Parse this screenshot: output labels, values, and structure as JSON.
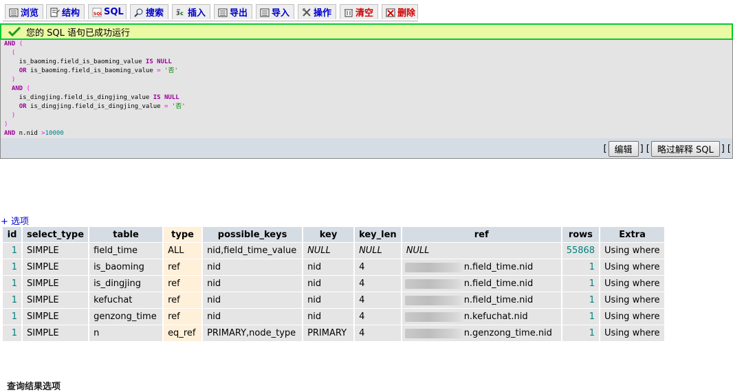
{
  "tabs": [
    {
      "label": "浏览",
      "icon": "browse-icon"
    },
    {
      "label": "结构",
      "icon": "structure-icon"
    },
    {
      "label": "SQL",
      "icon": "sql-icon"
    },
    {
      "label": "搜索",
      "icon": "search-icon"
    },
    {
      "label": "插入",
      "icon": "insert-icon"
    },
    {
      "label": "导出",
      "icon": "export-icon"
    },
    {
      "label": "导入",
      "icon": "import-icon"
    },
    {
      "label": "操作",
      "icon": "operations-icon"
    },
    {
      "label": "清空",
      "icon": "empty-icon"
    },
    {
      "label": "删除",
      "icon": "drop-icon"
    }
  ],
  "success": {
    "message": "您的 SQL 语句已成功运行"
  },
  "sql_lines": [
    "AND (",
    "  (",
    "    is_baoming.field_is_baoming_value IS NULL",
    "    OR is_baoming.field_is_baoming_value = '否'",
    "  )",
    "  AND (",
    "    is_dingjing.field_is_dingjing_value IS NULL",
    "    OR is_dingjing.field_is_dingjing_value = '否'",
    "  )",
    ")",
    "AND n.nid >10000"
  ],
  "sql_actions": {
    "edit": "编辑",
    "skip_explain": "略过解释 SQL"
  },
  "options_link": "+ 选项",
  "results": {
    "columns": [
      "id",
      "select_type",
      "table",
      "type",
      "possible_keys",
      "key",
      "key_len",
      "ref",
      "rows",
      "Extra"
    ],
    "rows": [
      [
        "1",
        "SIMPLE",
        "field_time",
        "ALL",
        "nid,field_time_value",
        "NULL",
        "NULL",
        "NULL",
        "55868",
        "Using where"
      ],
      [
        "1",
        "SIMPLE",
        "is_baoming",
        "ref",
        "nid",
        "nid",
        "4",
        "n.field_time.nid",
        "1",
        "Using where"
      ],
      [
        "1",
        "SIMPLE",
        "is_dingjing",
        "ref",
        "nid",
        "nid",
        "4",
        "n.field_time.nid",
        "1",
        "Using where"
      ],
      [
        "1",
        "SIMPLE",
        "kefuchat",
        "ref",
        "nid",
        "nid",
        "4",
        "n.field_time.nid",
        "1",
        "Using where"
      ],
      [
        "1",
        "SIMPLE",
        "genzong_time",
        "ref",
        "nid",
        "nid",
        "4",
        "n.kefuchat.nid",
        "1",
        "Using where"
      ],
      [
        "1",
        "SIMPLE",
        "n",
        "eq_ref",
        "PRIMARY,node_type",
        "PRIMARY",
        "4",
        "n.genzong_time.nid",
        "1",
        "Using where"
      ]
    ]
  },
  "footer_heading": "查询结果选项"
}
